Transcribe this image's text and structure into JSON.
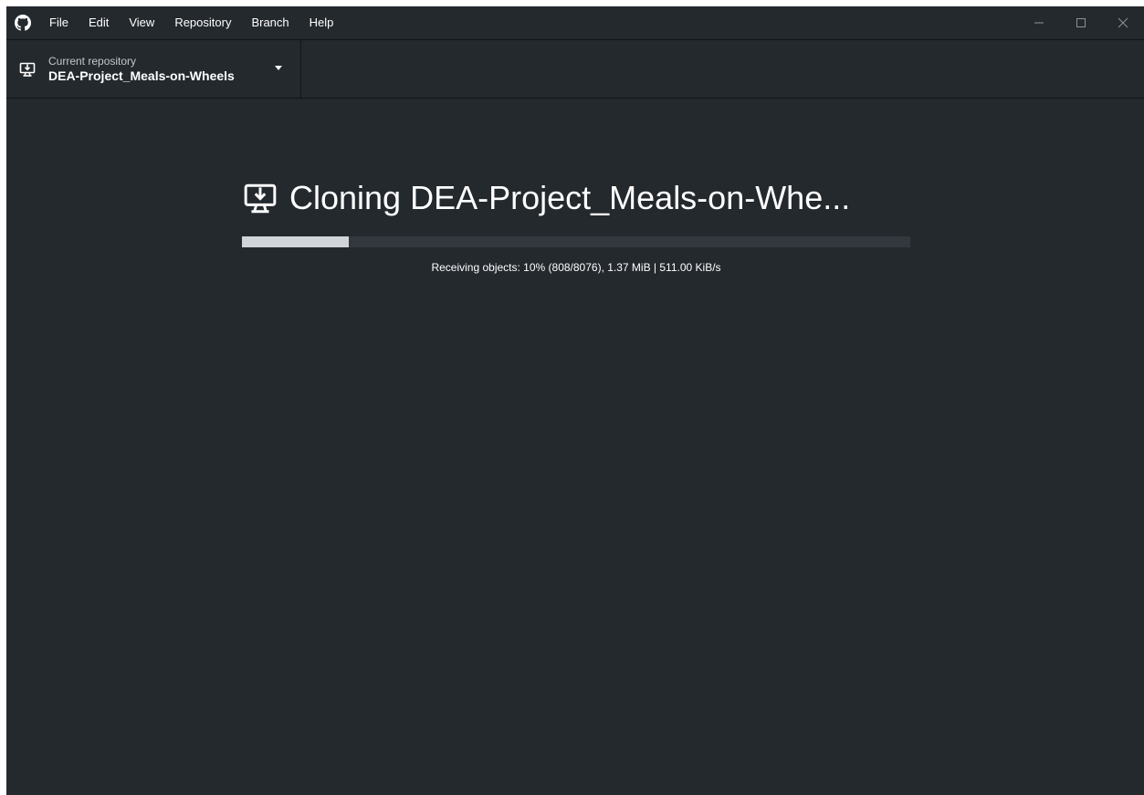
{
  "menu": {
    "items": [
      {
        "label": "File"
      },
      {
        "label": "Edit"
      },
      {
        "label": "View"
      },
      {
        "label": "Repository"
      },
      {
        "label": "Branch"
      },
      {
        "label": "Help"
      }
    ]
  },
  "toolbar": {
    "repo_label": "Current repository",
    "repo_name": "DEA-Project_Meals-on-Wheels"
  },
  "clone": {
    "title": "Cloning DEA-Project_Meals-on-Whe...",
    "progress_fraction": 0.16,
    "status_text": "Receiving objects: 10% (808/8076), 1.37 MiB | 511.00 KiB/s"
  },
  "icons": {
    "app_logo": "github-icon",
    "repo_icon": "clone-desktop-icon",
    "title_icon": "clone-desktop-icon"
  },
  "colors": {
    "background": "#24292e",
    "progress_fill": "#d1d5da",
    "progress_track": "#33383e"
  }
}
